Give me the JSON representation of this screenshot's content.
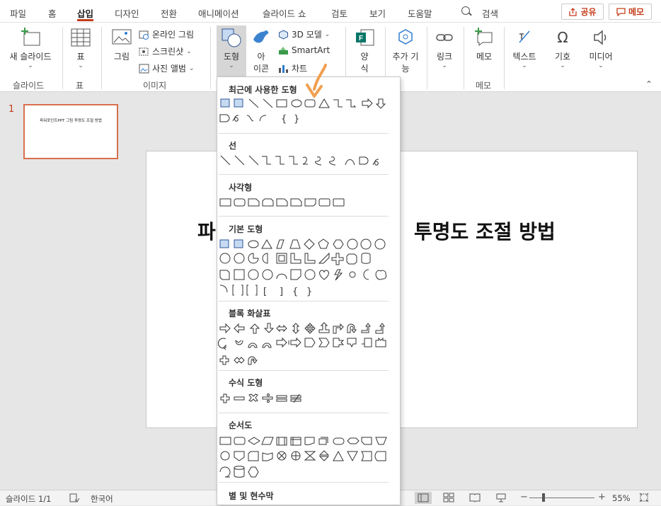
{
  "tabs": [
    "파일",
    "홈",
    "삽입",
    "디자인",
    "전환",
    "애니메이션",
    "슬라이드 쇼",
    "검토",
    "보기",
    "도움말"
  ],
  "active_tab": "삽입",
  "search_label": "검색",
  "share_label": "공유",
  "comment_label": "메모",
  "ribbon": {
    "new_slide": "새 슬라이드",
    "table": "표",
    "picture": "그림",
    "online_picture": "온라인 그림",
    "screenshot": "스크린샷",
    "photo_album": "사진 앨범",
    "shapes": "도형",
    "icons_line1": "아",
    "icons_line2": "이콘",
    "model3d": "3D 모델",
    "smartart": "SmartArt",
    "chart": "차트",
    "forms_line1": "양",
    "forms_line2": "식",
    "addins_line1": "추가 기",
    "addins_line2": "능",
    "link": "링크",
    "comment": "메모",
    "text": "텍스트",
    "symbols": "기호",
    "media": "미디어"
  },
  "groups": {
    "slides": "슬라이드",
    "tables": "표",
    "images": "이미지",
    "comments": "메모"
  },
  "dropdown": {
    "recent": "최근에 사용한 도형",
    "lines": "선",
    "rectangles": "사각형",
    "basic": "기본 도형",
    "block_arrows": "블록 화살표",
    "equation": "수식 도형",
    "flowchart": "순서도",
    "stars": "별 및 현수막"
  },
  "thumbnail": {
    "number": "1",
    "title": "파워포인트PPT 그림 투명도 조절 방법"
  },
  "slide_title_left": "파",
  "slide_title_right": "투명도 조절 방법",
  "status": {
    "slide_count": "슬라이드 1/1",
    "language": "한국어",
    "zoom": "55%"
  },
  "colors": {
    "accent": "#c43e1c",
    "arrow": "#f0a050",
    "shape_blue": "#2f5597"
  }
}
